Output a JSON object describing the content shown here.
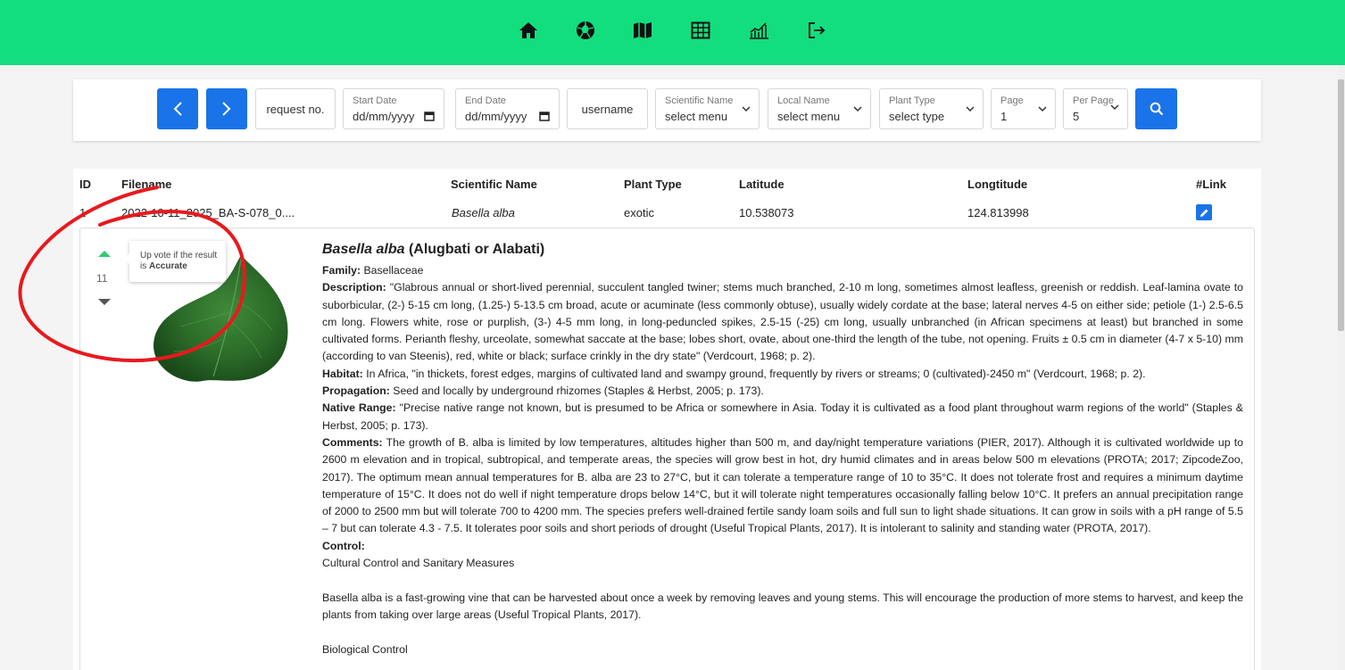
{
  "nav": {
    "icons": [
      "home-icon",
      "camera-aperture-icon",
      "map-icon",
      "table-icon",
      "chart-icon",
      "logout-icon"
    ]
  },
  "filters": {
    "request_placeholder": "request no.",
    "start_date_label": "Start Date",
    "start_date_value": "dd/mm/yyyy",
    "end_date_label": "End Date",
    "end_date_value": "dd/mm/yyyy",
    "username_placeholder": "username",
    "scientific_name_label": "Scientific Name",
    "scientific_name_value": "select menu",
    "local_name_label": "Local Name",
    "local_name_value": "select menu",
    "plant_type_label": "Plant Type",
    "plant_type_value": "select type",
    "page_label": "Page",
    "page_value": "1",
    "per_page_label": "Per Page",
    "per_page_value": "5"
  },
  "table": {
    "headers": {
      "id": "ID",
      "filename": "Filename",
      "scientific_name": "Scientific Name",
      "plant_type": "Plant Type",
      "latitude": "Latitude",
      "longitude": "Longtitude",
      "link": "#Link"
    },
    "row": {
      "id": "1",
      "filename": "2022-10-11_2025_BA-S-078_0....",
      "scientific_name": "Basella alba",
      "plant_type": "exotic",
      "latitude": "10.538073",
      "longitude": "124.813998"
    }
  },
  "detail": {
    "vote_count": "11",
    "tooltip_prefix": "Up vote if the result is",
    "tooltip_bold": "Accurate",
    "title_scientific": "Basella alba",
    "title_local": " (Alugbati or Alabati)",
    "family_label": "Family:",
    "family_value": "Basellaceae",
    "description_label": "Description:",
    "description_value": "\"Glabrous annual or short-lived perennial, succulent tangled twiner; stems much branched, 2-10 m long, sometimes almost leafless, greenish or reddish. Leaf-lamina ovate to suborbicular, (2-) 5-15 cm long, (1.25-) 5-13.5 cm broad, acute or acuminate (less commonly obtuse), usually widely cordate at the base; lateral nerves 4-5 on either side; petiole (1-) 2.5-6.5 cm long. Flowers white, rose or purplish, (3-) 4-5 mm long, in long-peduncled spikes, 2.5-15 (-25) cm long, usually unbranched (in African specimens at least) but branched in some cultivated forms. Perianth fleshy, urceolate, somewhat saccate at the base; lobes short, ovate, about one-third the length of the tube, not opening. Fruits ± 0.5 cm in diameter (4-7 x 5-10) mm (according to van Steenis), red, white or black; surface crinkly in the dry state\" (Verdcourt, 1968; p. 2).",
    "habitat_label": "Habitat:",
    "habitat_value": "In Africa, \"in thickets, forest edges, margins of cultivated land and swampy ground, frequently by rivers or streams; 0 (cultivated)-2450 m\" (Verdcourt, 1968; p. 2).",
    "propagation_label": "Propagation:",
    "propagation_value": "Seed and locally by underground rhizomes (Staples & Herbst, 2005; p. 173).",
    "native_range_label": "Native Range:",
    "native_range_value": "\"Precise native range not known, but is presumed to be Africa or somewhere in Asia. Today it is cultivated as a food plant throughout warm regions of the world\" (Staples & Herbst, 2005; p. 173).",
    "comments_label": "Comments:",
    "comments_value": "The growth of B. alba is limited by low temperatures, altitudes higher than 500 m, and day/night temperature variations (PIER, 2017). Although it is cultivated worldwide up to 2600 m elevation and in tropical, subtropical, and temperate areas, the species will grow best in hot, dry humid climates and in areas below 500 m elevations (PROTA; 2017; ZipcodeZoo, 2017). The optimum mean annual temperatures for B. alba are 23 to 27°C, but it can tolerate a temperature range of 10 to 35°C. It does not tolerate frost and requires a minimum daytime temperature of 15°C. It does not do well if night temperature drops below 14°C, but it will tolerate night temperatures occasionally falling below 10°C. It prefers an annual precipitation range of 2000 to 2500 mm but will tolerate 700 to 4200 mm. The species prefers well-drained fertile sandy loam soils and full sun to light shade situations. It can grow in soils with a pH range of 5.5 – 7 but can tolerate 4.3 - 7.5. It tolerates poor soils and short periods of drought (Useful Tropical Plants, 2017). It is intolerant to salinity and standing water (PROTA, 2017).",
    "control_label": "Control:",
    "control_sub": "Cultural Control and Sanitary Measures",
    "control_text": "Basella alba is a fast-growing vine that can be harvested about once a week by removing leaves and young stems. This will encourage the production of more stems to harvest, and keep the plants from taking over large areas (Useful Tropical Plants, 2017).",
    "bio_control_label": "Biological Control"
  },
  "colors": {
    "nav_green": "#12de7e",
    "button_blue": "#1a73e8",
    "vote_up_green": "#2ecc71",
    "annotation_red": "#e8191d"
  }
}
